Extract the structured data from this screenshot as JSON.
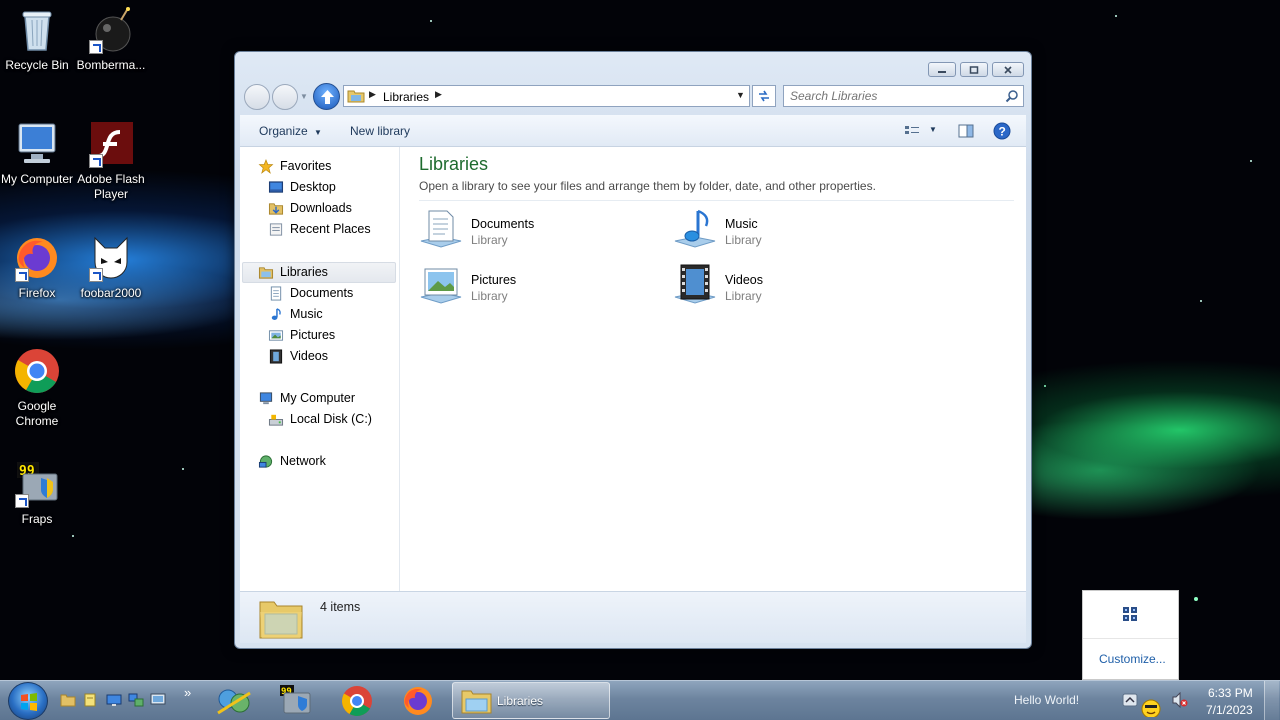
{
  "desktop": {
    "icons": [
      {
        "label": "Recycle Bin"
      },
      {
        "label": "Bomberma..."
      },
      {
        "label": "My Computer"
      },
      {
        "label": "Adobe Flash Player"
      },
      {
        "label": "Firefox"
      },
      {
        "label": "foobar2000"
      },
      {
        "label": "Google Chrome"
      },
      {
        "label": "Fraps"
      }
    ]
  },
  "window": {
    "breadcrumb": "Libraries",
    "search_placeholder": "Search Libraries",
    "toolbar": {
      "organize": "Organize",
      "new_library": "New library"
    },
    "nav": {
      "favorites": "Favorites",
      "desktop": "Desktop",
      "downloads": "Downloads",
      "recent_places": "Recent Places",
      "libraries": "Libraries",
      "documents": "Documents",
      "music": "Music",
      "pictures": "Pictures",
      "videos": "Videos",
      "my_computer": "My Computer",
      "local_disk": "Local Disk (C:)",
      "network": "Network"
    },
    "main": {
      "title": "Libraries",
      "description": "Open a library to see your files and arrange them by folder, date, and other properties.",
      "libraries": [
        {
          "name": "Documents",
          "type": "Library"
        },
        {
          "name": "Music",
          "type": "Library"
        },
        {
          "name": "Pictures",
          "type": "Library"
        },
        {
          "name": "Videos",
          "type": "Library"
        }
      ]
    },
    "status": {
      "item_count": "4 items"
    }
  },
  "tray_popup": {
    "customize": "Customize..."
  },
  "taskbar": {
    "active_window": "Libraries",
    "tray_text": "Hello World!",
    "time": "6:33 PM",
    "date": "7/1/2023"
  },
  "colors": {
    "title_green": "#1e6b2e",
    "link_blue": "#1f5fa8",
    "toolbar_text": "#1e395b"
  }
}
